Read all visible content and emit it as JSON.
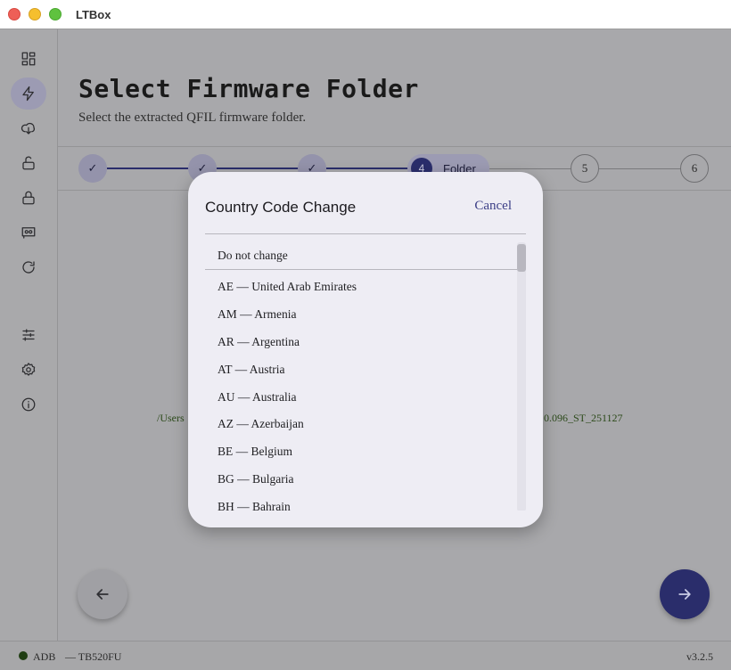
{
  "window": {
    "title": "LTBox"
  },
  "sidebar": {
    "items": [
      {
        "name": "dashboard-icon"
      },
      {
        "name": "flash-icon",
        "active": true
      },
      {
        "name": "cloud-download-icon"
      },
      {
        "name": "unlock-icon"
      },
      {
        "name": "lock-icon"
      },
      {
        "name": "device-icon"
      },
      {
        "name": "refresh-icon"
      },
      {
        "name": "sliders-icon"
      },
      {
        "name": "gear-icon"
      },
      {
        "name": "info-icon"
      }
    ]
  },
  "page": {
    "title": "Select Firmware Folder",
    "subtitle": "Select the extracted QFIL firmware folder."
  },
  "stepper": {
    "done_mark": "✓",
    "current": {
      "number": "4",
      "label": "Folder"
    },
    "next_steps": [
      "5",
      "6"
    ]
  },
  "path": {
    "left": "/Users",
    "right": "0.096_ST_251127"
  },
  "status": {
    "adb": "ADB",
    "device": "— TB520FU",
    "version": "v3.2.5"
  },
  "dialog": {
    "title": "Country Code Change",
    "cancel": "Cancel",
    "options": [
      "Do not change",
      "AE — United Arab Emirates",
      "AM — Armenia",
      "AR — Argentina",
      "AT — Austria",
      "AU — Australia",
      "AZ — Azerbaijan",
      "BE — Belgium",
      "BG — Bulgaria",
      "BH — Bahrain"
    ]
  },
  "colors": {
    "accent": "#2a2d6b",
    "dialog_bg": "#eeedf4",
    "cancel_text": "#3b3e86"
  }
}
